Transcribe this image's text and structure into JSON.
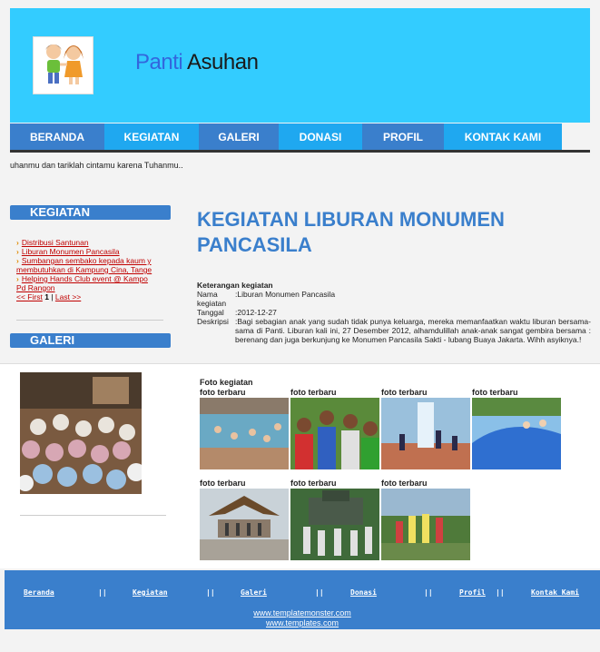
{
  "header": {
    "title_part1": "Panti",
    "title_part2": "Asuhan",
    "bg_color": "#33ccff"
  },
  "nav": [
    "BERANDA",
    "KEGIATAN",
    "GALERI",
    "DONASI",
    "PROFIL",
    "KONTAK KAMI"
  ],
  "marquee": "uhanmu dan tariklah cintamu karena Tuhanmu..",
  "sidebar": {
    "kegiatan_heading": "KEGIATAN",
    "items": [
      [
        "Distribusi Santunan"
      ],
      [
        "Liburan Monumen Pancasila"
      ],
      [
        "Sumbangan sembako kepada kaum y",
        "membutuhkan di Kampung Cina, Tange"
      ],
      [
        "Helping Hands Club event @ Kampo",
        "Pd Rangon"
      ]
    ],
    "pager_first": "<< First",
    "pager_page": "1",
    "pager_sep": "|",
    "pager_last": "Last >>",
    "galeri_heading": "GALERI"
  },
  "main": {
    "title": "KEGIATAN LIBURAN MONUMEN PANCASILA",
    "detail_heading": "Keterangan kegiatan",
    "nama_label": "Nama",
    "nama_value": ":Liburan Monumen Pancasila",
    "kegiatan_label": "kegiatan",
    "tanggal_label": "Tanggal",
    "tanggal_value": ":2012-12-27",
    "deskripsi_label": "Deskripsi",
    "deskripsi_value": ":Bagi sebagian anak yang sudah tidak punya keluarga, mereka memanfaatkan waktu liburan bersama-sama di Panti. Liburan kali ini, 27 Desember 2012, alhamdulillah anak-anak sangat gembira bersama : berenang dan juga berkunjung ke Monumen Pancasila Sakti - lubang Buaya Jakarta. Wihh asyiknya.!"
  },
  "gallery": {
    "foto_kegiatan": "Foto kegiatan",
    "caption": "foto terbaru",
    "thumb_count": 7
  },
  "footer": {
    "links": [
      "Beranda",
      "Kegiatan",
      "Galeri",
      "Donasi",
      "Profil",
      "Kontak Kami"
    ],
    "separator": "||",
    "credit1": "www.templatemonster.com",
    "credit2": "www.templates.com"
  }
}
